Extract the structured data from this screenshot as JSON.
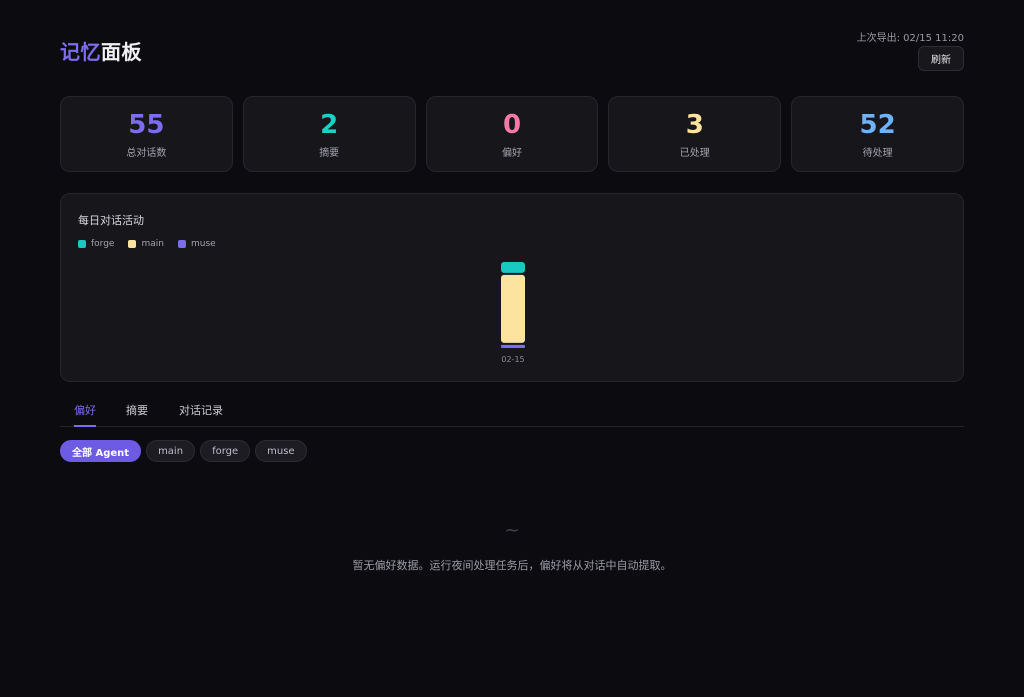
{
  "header": {
    "title_accent": "记忆",
    "title_rest": "面板",
    "last_export": "上次导出: 02/15 11:20",
    "refresh_label": "刷新"
  },
  "stats": [
    {
      "value": "55",
      "label": "总对话数",
      "color": "#7c6cf0"
    },
    {
      "value": "2",
      "label": "摘要",
      "color": "#19d1c4"
    },
    {
      "value": "0",
      "label": "偏好",
      "color": "#f47aa6"
    },
    {
      "value": "3",
      "label": "已处理",
      "color": "#fde3a0"
    },
    {
      "value": "52",
      "label": "待处理",
      "color": "#6fb2f7"
    }
  ],
  "chart": {
    "title": "每日对话活动"
  },
  "chart_data": {
    "type": "bar",
    "stacked": true,
    "categories": [
      "02-15"
    ],
    "series": [
      {
        "name": "forge",
        "values": [
          7
        ],
        "color": "#19c9c1"
      },
      {
        "name": "main",
        "values": [
          44
        ],
        "color": "#fde3a0"
      },
      {
        "name": "muse",
        "values": [
          2
        ],
        "color": "#7c6cf0"
      }
    ],
    "legend_position": "top-left",
    "grid": false
  },
  "tabs": [
    {
      "label": "偏好",
      "active": true
    },
    {
      "label": "摘要",
      "active": false
    },
    {
      "label": "对话记录",
      "active": false
    }
  ],
  "filters": [
    {
      "label": "全部 Agent",
      "active": true
    },
    {
      "label": "main",
      "active": false
    },
    {
      "label": "forge",
      "active": false
    },
    {
      "label": "muse",
      "active": false
    }
  ],
  "empty_state": {
    "icon": "~",
    "message": "暂无偏好数据。运行夜间处理任务后，偏好将从对话中自动提取。"
  }
}
